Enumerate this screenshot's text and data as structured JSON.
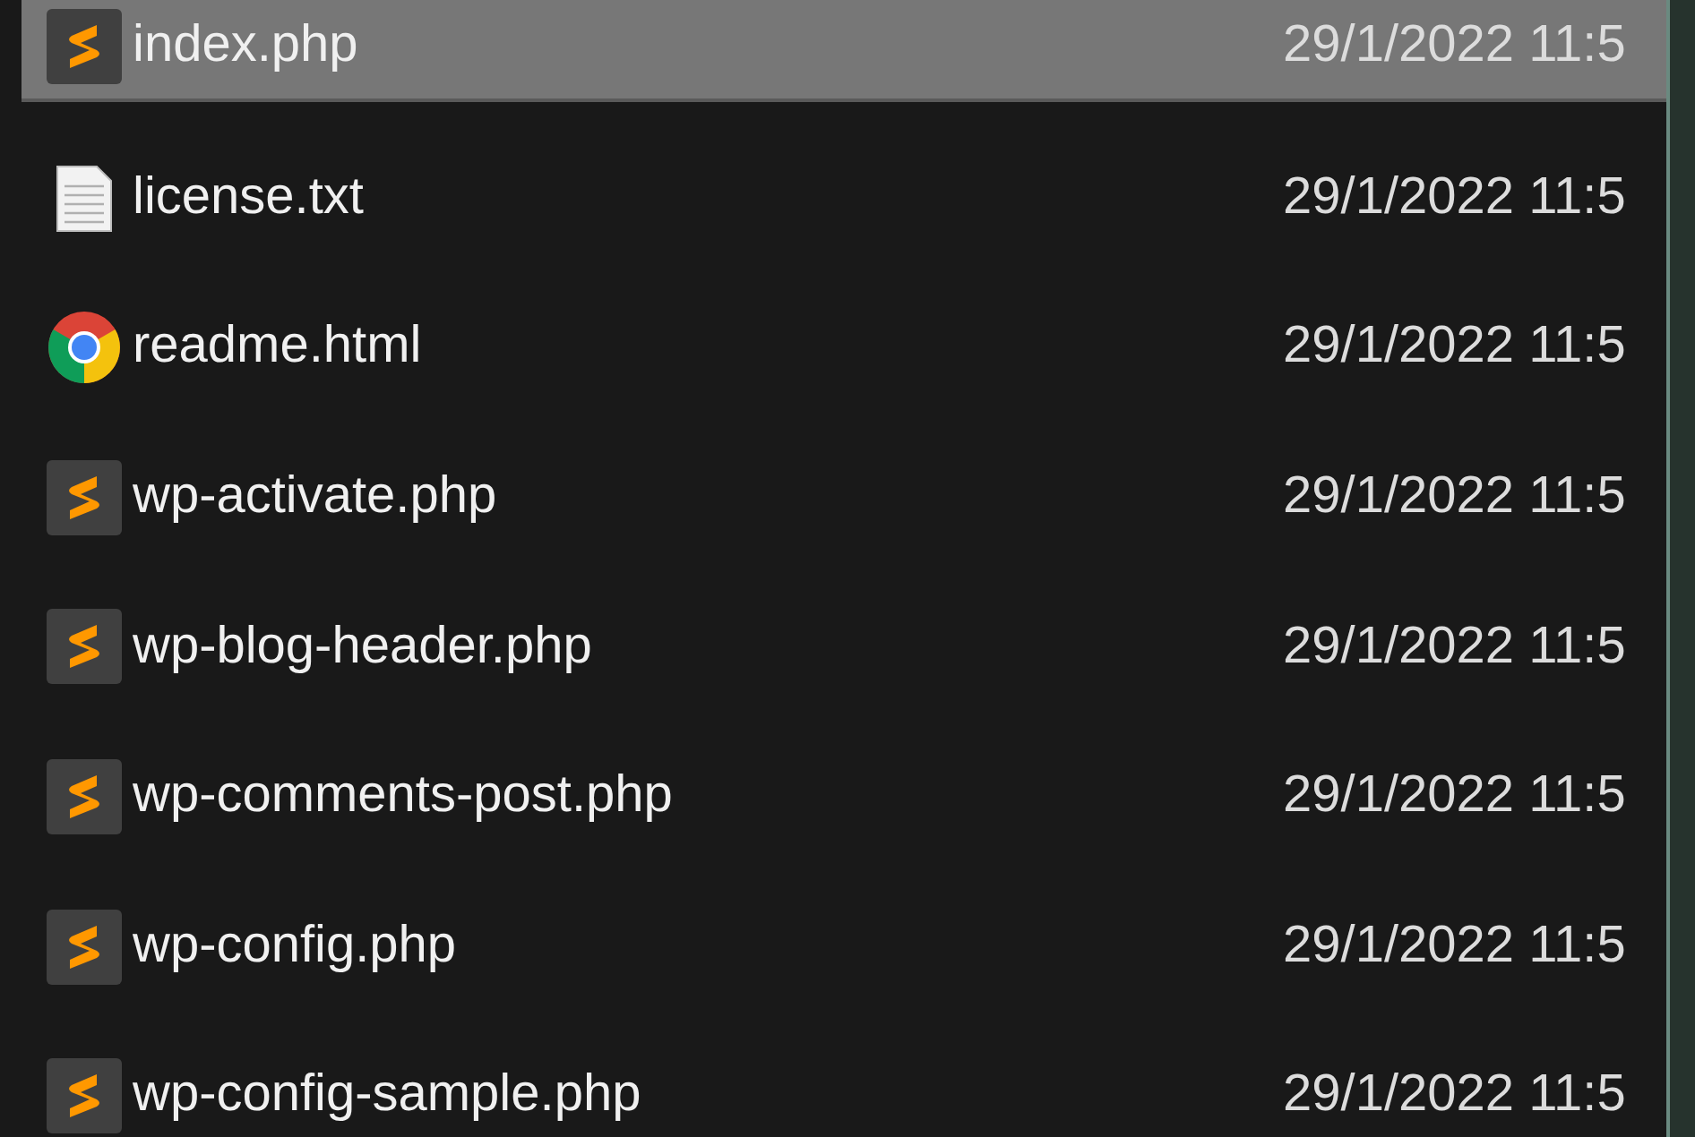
{
  "files": [
    {
      "name": "index.php",
      "kind": "php",
      "date": "29/1/2022 11:5",
      "selected": true
    },
    {
      "name": "license.txt",
      "kind": "text",
      "date": "29/1/2022 11:5",
      "selected": false
    },
    {
      "name": "readme.html",
      "kind": "html",
      "date": "29/1/2022 11:5",
      "selected": false
    },
    {
      "name": "wp-activate.php",
      "kind": "php",
      "date": "29/1/2022 11:5",
      "selected": false
    },
    {
      "name": "wp-blog-header.php",
      "kind": "php",
      "date": "29/1/2022 11:5",
      "selected": false
    },
    {
      "name": "wp-comments-post.php",
      "kind": "php",
      "date": "29/1/2022 11:5",
      "selected": false
    },
    {
      "name": "wp-config.php",
      "kind": "php",
      "date": "29/1/2022 11:5",
      "selected": false
    },
    {
      "name": "wp-config-sample.php",
      "kind": "php",
      "date": "29/1/2022 11:5",
      "selected": false
    }
  ]
}
